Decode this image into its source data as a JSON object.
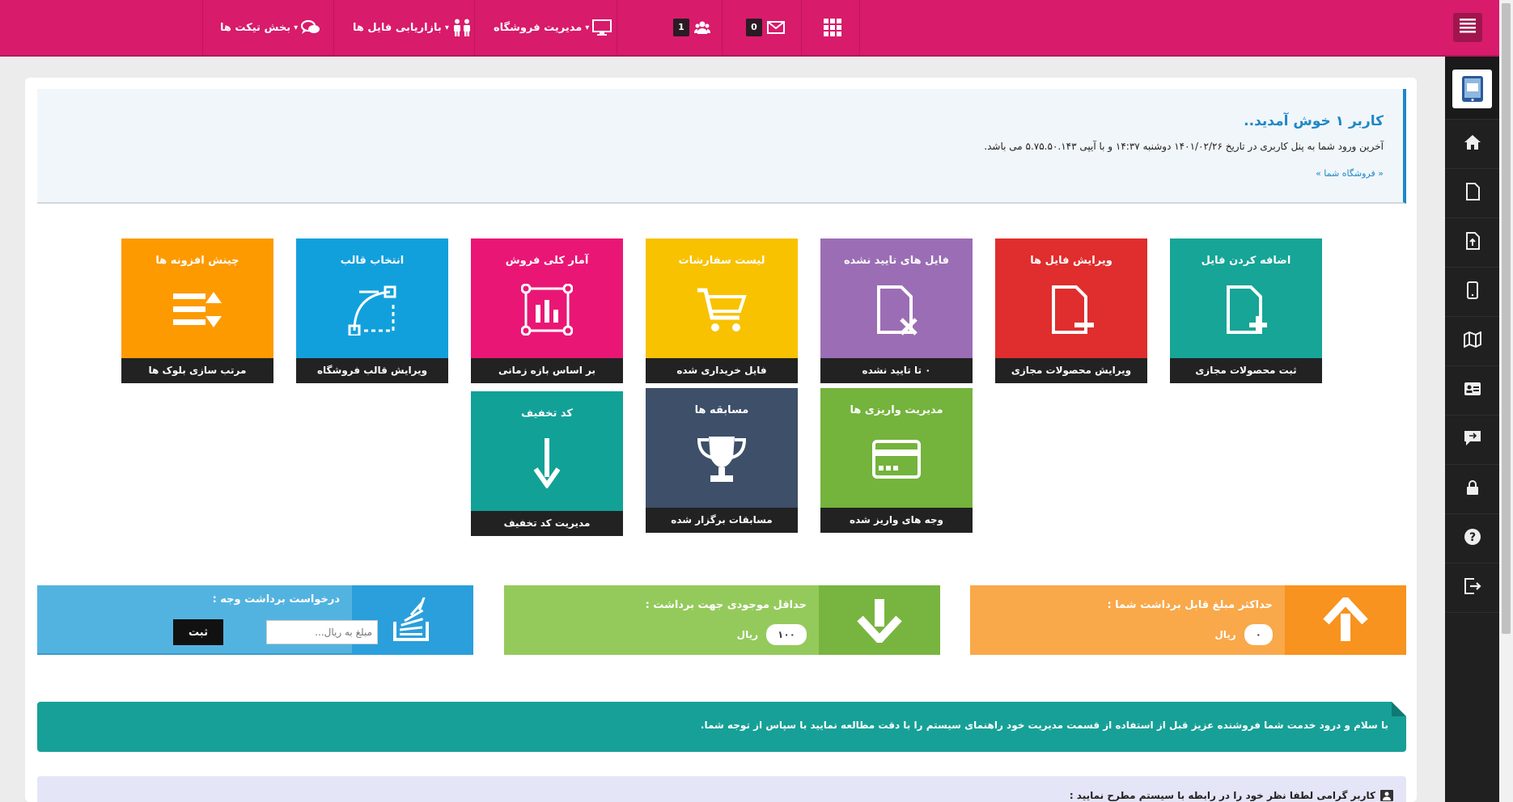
{
  "topbar": {
    "nav": [
      {
        "label": "بخش تیکت ها",
        "icon": "chat-bubbles-icon"
      },
      {
        "label": "بازاریابی فایل ها",
        "icon": "people-icon"
      },
      {
        "label": "مدیریت فروشگاه",
        "icon": "monitor-icon"
      }
    ],
    "users_count": "1",
    "messages_count": "0",
    "accent": "#d81b6b"
  },
  "sidebar": {
    "items": [
      {
        "icon": "home-icon"
      },
      {
        "icon": "file-icon"
      },
      {
        "icon": "file-upload-icon"
      },
      {
        "icon": "mobile-icon"
      },
      {
        "icon": "map-icon"
      },
      {
        "icon": "id-card-icon"
      },
      {
        "icon": "comment-icon"
      },
      {
        "icon": "lock-icon"
      },
      {
        "icon": "help-icon"
      },
      {
        "icon": "logout-icon"
      }
    ]
  },
  "welcome": {
    "title": "کاربر ۱ خوش آمدید..",
    "text": "آخرین ورود شما به پنل کاربری در تاریخ ۱۴۰۱/۰۲/۲۶ دوشنبه ۱۴:۳۷ و با آیپی ۵.۷۵.۵۰.۱۴۳ می باشد.",
    "link": "« فروشگاه شما »"
  },
  "tiles": [
    {
      "title": "اضافه کردن فایل",
      "footer": "ثبت محصولات مجازی",
      "color": "#16a597",
      "icon": "file-add-icon"
    },
    {
      "title": "ویرایش فایل ها",
      "footer": "ویرایش محصولات مجازی",
      "color": "#e02d2d",
      "icon": "file-minus-icon"
    },
    {
      "title": "فایل های تایید نشده",
      "footer": "۰ تا تایید نشده",
      "color": "#9b6db5",
      "icon": "file-reject-icon"
    },
    {
      "title": "لیست سفارشات",
      "footer": "فایل خریداری شده",
      "color": "#f8c200",
      "icon": "cart-icon"
    },
    {
      "title": "آمار کلی فروش",
      "footer": "بر اساس بازه زمانی",
      "color": "#ea1675",
      "icon": "bar-chart-icon"
    },
    {
      "title": "انتخاب قالب",
      "footer": "ویرایش قالب فروشگاه",
      "color": "#12a0dc",
      "icon": "vector-pen-icon"
    },
    {
      "title": "چینش افزونه ها",
      "footer": "مرتب سازی بلوک ها",
      "color": "#fd9a00",
      "icon": "sort-list-icon"
    },
    {
      "title": "مدیریت واریزی ها",
      "footer": "وجه های واریز شده",
      "color": "#74b33c",
      "icon": "credit-card-icon"
    },
    {
      "title": "مسابقه ها",
      "footer": "مسابقات برگزار شده",
      "color": "#3d4f69",
      "icon": "trophy-icon"
    },
    {
      "title": "کد تخفیف",
      "footer": "مدیریت کد تخفیف",
      "color": "#12a197",
      "icon": "arrow-down-icon"
    }
  ],
  "stats": {
    "max_withdraw": {
      "label": "حداکثر مبلغ قابل برداشت شما :",
      "value": "۰",
      "unit": "ریال"
    },
    "min_balance": {
      "label": "حداقل موجودی جهت برداشت :",
      "value": "۱۰۰",
      "unit": "ریال"
    },
    "withdraw_request": {
      "label": "درخواست برداشت وجه :",
      "placeholder": "مبلغ به ریال...",
      "submit": "ثبت"
    }
  },
  "notice": {
    "text": "با سلام و درود خدمت شما فروشنده عزیز قبل از استفاده از قسمت مدیریت خود راهنمای سیستم را با دقت مطالعه نمایید با سپاس از توجه شما."
  },
  "feedback": {
    "text": "کاربر گرامی لطفا نظر خود را در رابطه با سیستم مطرح نمایید :"
  }
}
